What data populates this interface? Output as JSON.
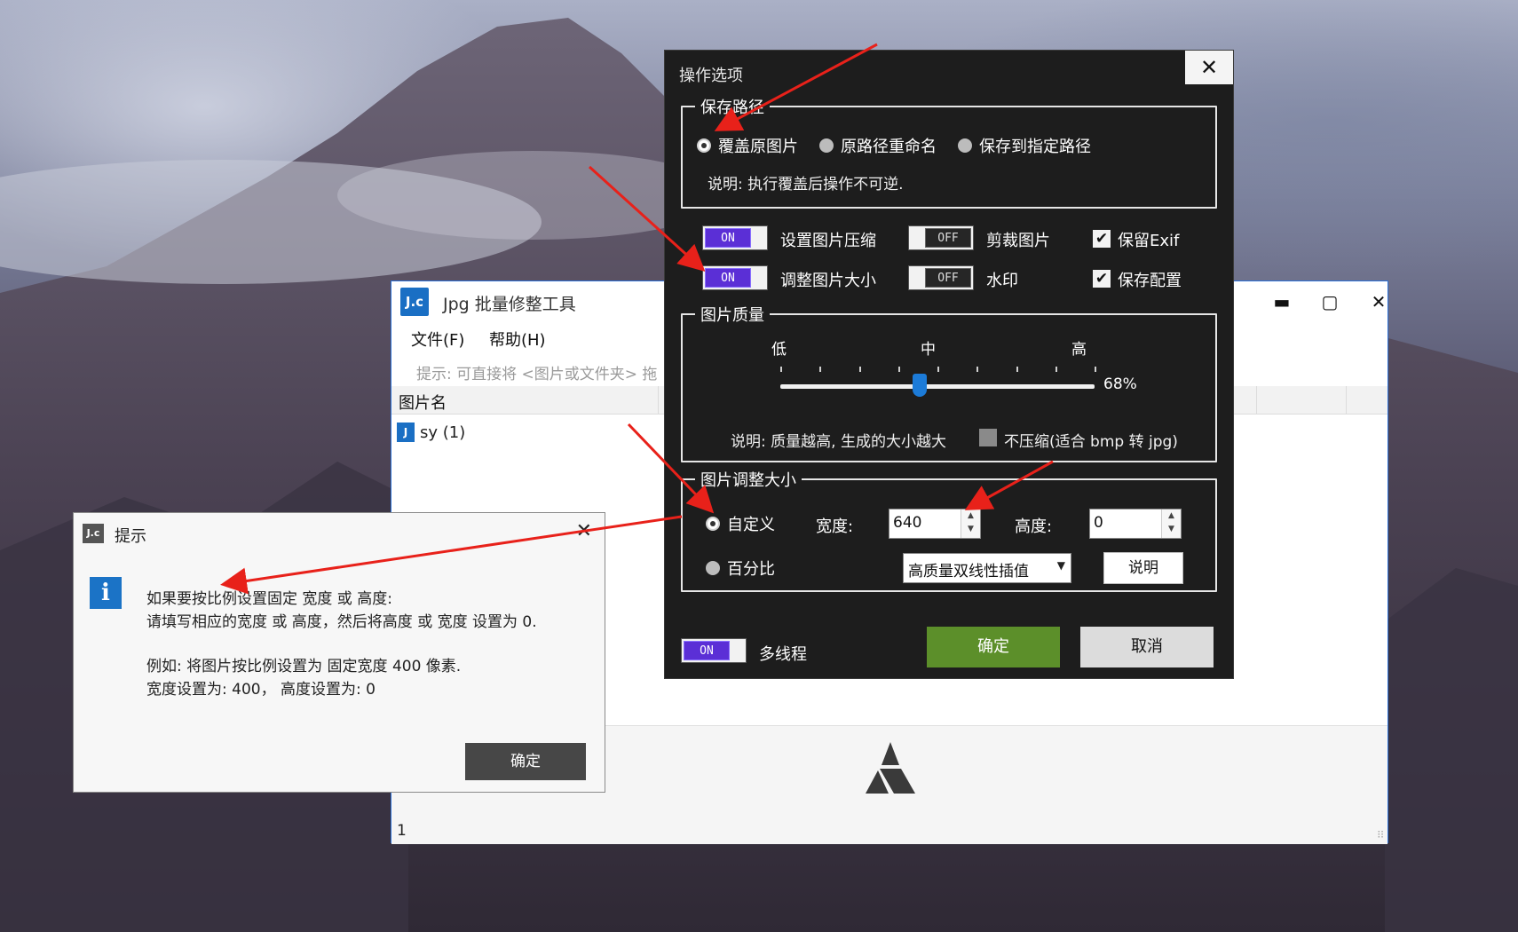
{
  "main_window": {
    "title": "Jpg 批量修整工具",
    "logo": "J.c",
    "menu": [
      "文件(F)",
      "帮助(H)"
    ],
    "hint": "提示: 可直接将 <图片或文件夹> 拖",
    "column_header": "图片名",
    "files": [
      {
        "name": "sy (1)",
        "icon": "jpg-file-icon"
      }
    ],
    "status_count": "1"
  },
  "options_dialog": {
    "title": "操作选项",
    "close_glyph": "✕",
    "save_path": {
      "legend": "保存路径",
      "options": [
        "覆盖原图片",
        "原路径重命名",
        "保存到指定路径"
      ],
      "selected_index": 0,
      "note": "说明: 执行覆盖后操作不可逆."
    },
    "toggles": [
      {
        "state": "ON",
        "label": "设置图片压缩"
      },
      {
        "state": "OFF",
        "label": "剪裁图片"
      },
      {
        "state": "ON",
        "label": "调整图片大小"
      },
      {
        "state": "OFF",
        "label": "水印"
      }
    ],
    "checkboxes": [
      {
        "label": "保留Exif",
        "checked": true
      },
      {
        "label": "保存配置",
        "checked": true
      }
    ],
    "quality": {
      "legend": "图片质量",
      "low": "低",
      "mid": "中",
      "high": "高",
      "value_pct": 68,
      "value_label": "68%",
      "note": "说明: 质量越高, 生成的大小越大",
      "no_compress_label": "不压缩(适合 bmp 转 jpg)",
      "no_compress_checked": false
    },
    "resize": {
      "legend": "图片调整大小",
      "mode_custom": "自定义",
      "mode_percent": "百分比",
      "selected": "custom",
      "width_label": "宽度:",
      "width_value": "640",
      "height_label": "高度:",
      "height_value": "0",
      "interp_value": "高质量双线性插值",
      "help_button": "说明"
    },
    "multithread": {
      "state": "ON",
      "label": "多线程"
    },
    "ok": "确定",
    "cancel": "取消"
  },
  "tip_dialog": {
    "title": "提示",
    "logo": "J.c",
    "close_glyph": "✕",
    "lines": [
      "如果要按比例设置固定 宽度 或 高度:",
      "请填写相应的宽度 或 高度，然后将高度 或 宽度 设置为 0.",
      "例如: 将图片按比例设置为 固定宽度 400 像素.",
      "宽度设置为: 400，  高度设置为: 0"
    ],
    "ok": "确定"
  },
  "colors": {
    "toggle_on": "#5b2fd6",
    "ok_green": "#5c8f2a",
    "annotation_red": "#e8211a",
    "window_border": "#2b6fd6"
  }
}
